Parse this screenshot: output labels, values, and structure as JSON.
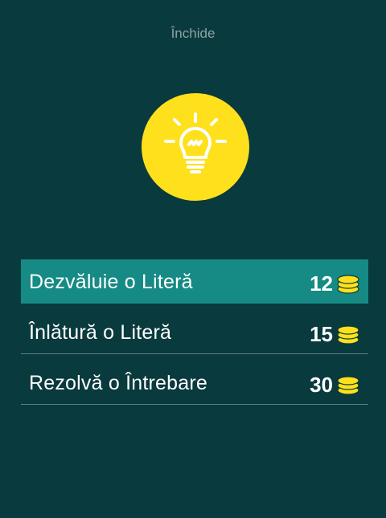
{
  "header": {
    "close_label": "Închide"
  },
  "hint": {
    "icon": "lightbulb-icon",
    "badge_color": "#ffe01c"
  },
  "options": [
    {
      "label": "Dezvăluie o Literă",
      "cost": "12",
      "icon": "coins-icon",
      "selected": true
    },
    {
      "label": "Înlătură o Literă",
      "cost": "15",
      "icon": "coins-icon",
      "selected": false
    },
    {
      "label": "Rezolvă o Întrebare",
      "cost": "30",
      "icon": "coins-icon",
      "selected": false
    }
  ],
  "colors": {
    "background": "#093a3d",
    "selected_row": "#168a84",
    "coin": "#ffe01c",
    "divider": "#5e8082"
  }
}
